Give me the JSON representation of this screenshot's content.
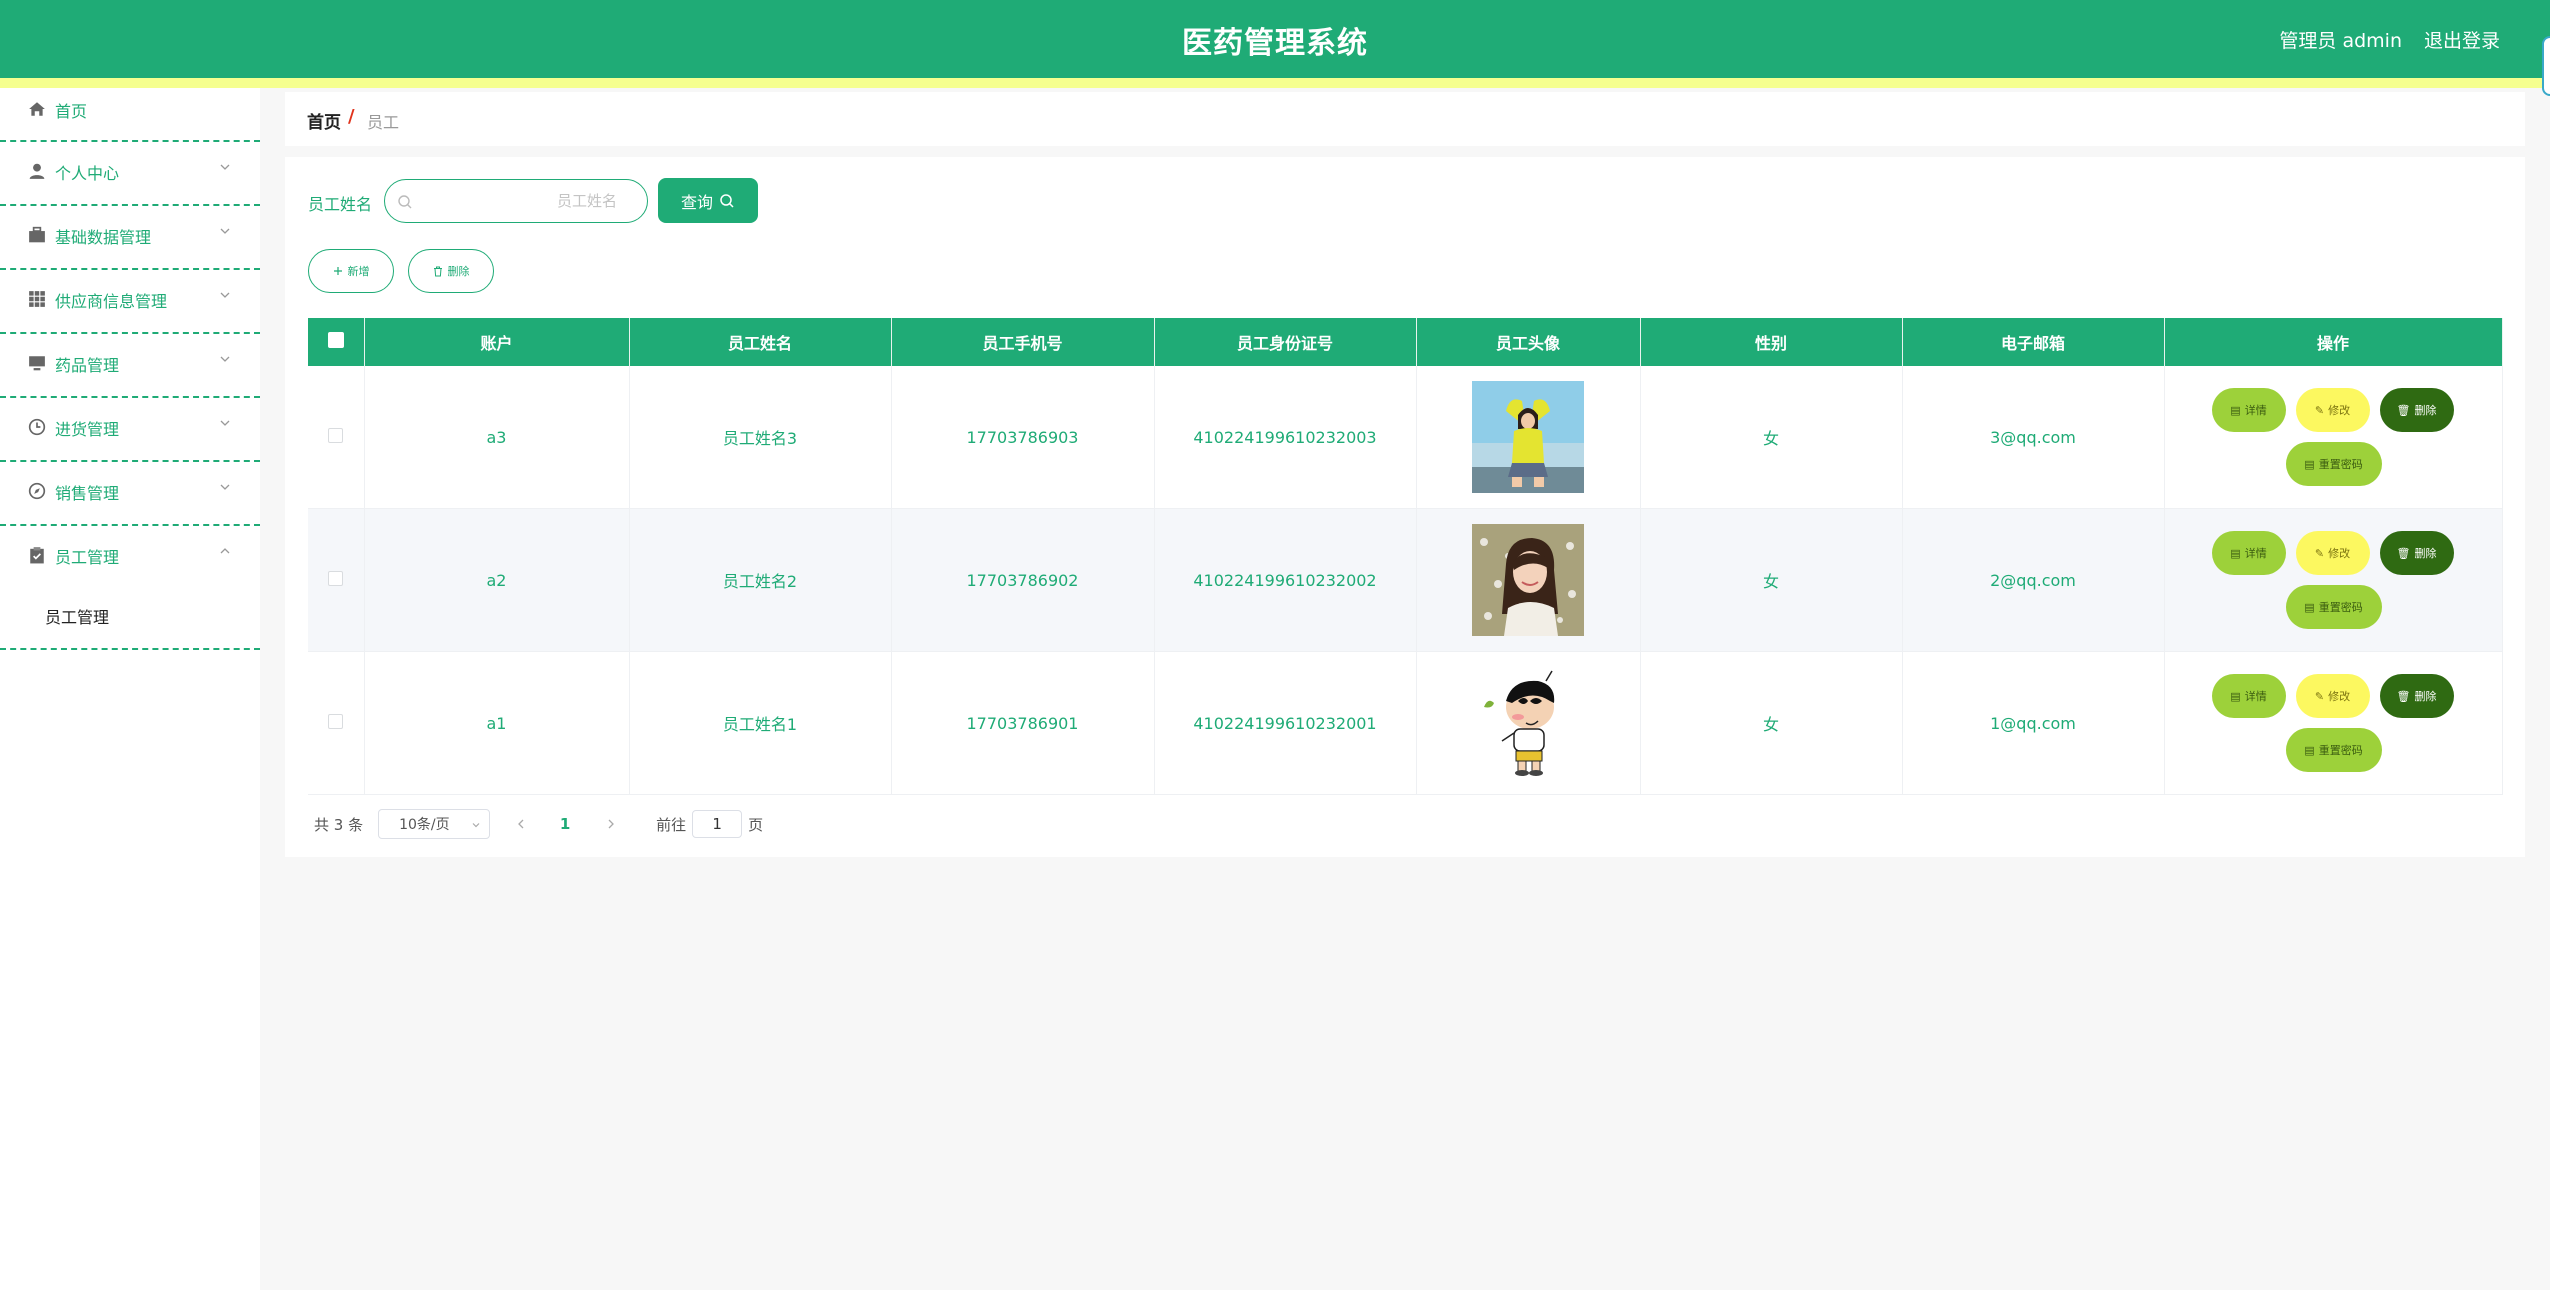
{
  "header": {
    "title": "医药管理系统",
    "user": "管理员 admin",
    "logout": "退出登录"
  },
  "sidebar": {
    "home": "首页",
    "items": [
      {
        "label": "个人中心",
        "icon": "user-icon"
      },
      {
        "label": "基础数据管理",
        "icon": "briefcase-icon"
      },
      {
        "label": "供应商信息管理",
        "icon": "grid-icon"
      },
      {
        "label": "药品管理",
        "icon": "monitor-icon"
      },
      {
        "label": "进货管理",
        "icon": "clock-icon"
      },
      {
        "label": "销售管理",
        "icon": "compass-icon"
      },
      {
        "label": "员工管理",
        "icon": "clipboard-icon"
      }
    ],
    "subitem": "员工管理"
  },
  "breadcrumb": {
    "home": "首页",
    "sep": "/",
    "current": "员工"
  },
  "search": {
    "label": "员工姓名",
    "placeholder": "员工姓名",
    "query_button": "查询"
  },
  "actions": {
    "add": "新增",
    "delete": "删除"
  },
  "table": {
    "headers": [
      "账户",
      "员工姓名",
      "员工手机号",
      "员工身份证号",
      "员工头像",
      "性别",
      "电子邮箱",
      "操作"
    ],
    "rows": [
      {
        "account": "a3",
        "name": "员工姓名3",
        "phone": "17703786903",
        "id_card": "410224199610232003",
        "avatar": "girl-yellow-photo",
        "gender": "女",
        "email": "3@qq.com"
      },
      {
        "account": "a2",
        "name": "员工姓名2",
        "phone": "17703786902",
        "id_card": "410224199610232002",
        "avatar": "girl-flowers-photo",
        "gender": "女",
        "email": "2@qq.com"
      },
      {
        "account": "a1",
        "name": "员工姓名1",
        "phone": "17703786901",
        "id_card": "410224199610232001",
        "avatar": "cartoon-boy",
        "gender": "女",
        "email": "1@qq.com"
      }
    ],
    "ops": {
      "detail": "详情",
      "edit": "修改",
      "delete": "删除",
      "reset": "重置密码"
    }
  },
  "pagination": {
    "total": "共 3 条",
    "page_size": "10条/页",
    "current": "1",
    "goto_prefix": "前往",
    "goto_value": "1",
    "goto_suffix": "页"
  },
  "colors": {
    "primary": "#1fab76",
    "stripe": "#f5ff8f",
    "detail": "#9dd13a",
    "edit": "#fcf860",
    "delete": "#2f6a12"
  }
}
